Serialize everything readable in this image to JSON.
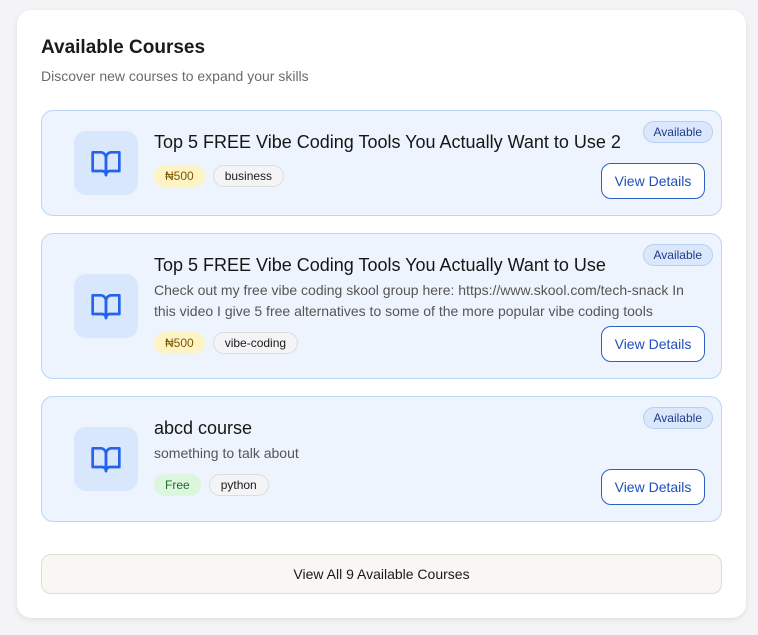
{
  "header": {
    "title": "Available Courses",
    "subtitle": "Discover new courses to expand your skills"
  },
  "colors": {
    "accent": "#1e4fb8",
    "card_bg": "#eef4fe",
    "price_tag_bg": "#fdf3c4",
    "free_tag_bg": "#dcf5dd"
  },
  "courses": [
    {
      "icon": "book-open-icon",
      "title": "Top 5 FREE Vibe Coding Tools You Actually Want to Use 2",
      "description": "",
      "price": "₦500",
      "category": "business",
      "status": "Available",
      "button_label": "View Details"
    },
    {
      "icon": "book-open-icon",
      "title": "Top 5 FREE Vibe Coding Tools You Actually Want to Use",
      "description": "Check out my free vibe coding skool group here: https://www.skool.com/tech-snack In this video I give 5 free alternatives to some of the more popular vibe coding tools",
      "price": "₦500",
      "category": "vibe-coding",
      "status": "Available",
      "button_label": "View Details"
    },
    {
      "icon": "book-open-icon",
      "title": "abcd course",
      "description": "something to talk about",
      "price": "Free",
      "category": "python",
      "status": "Available",
      "button_label": "View Details"
    }
  ],
  "footer": {
    "view_all_label": "View All 9 Available Courses"
  }
}
